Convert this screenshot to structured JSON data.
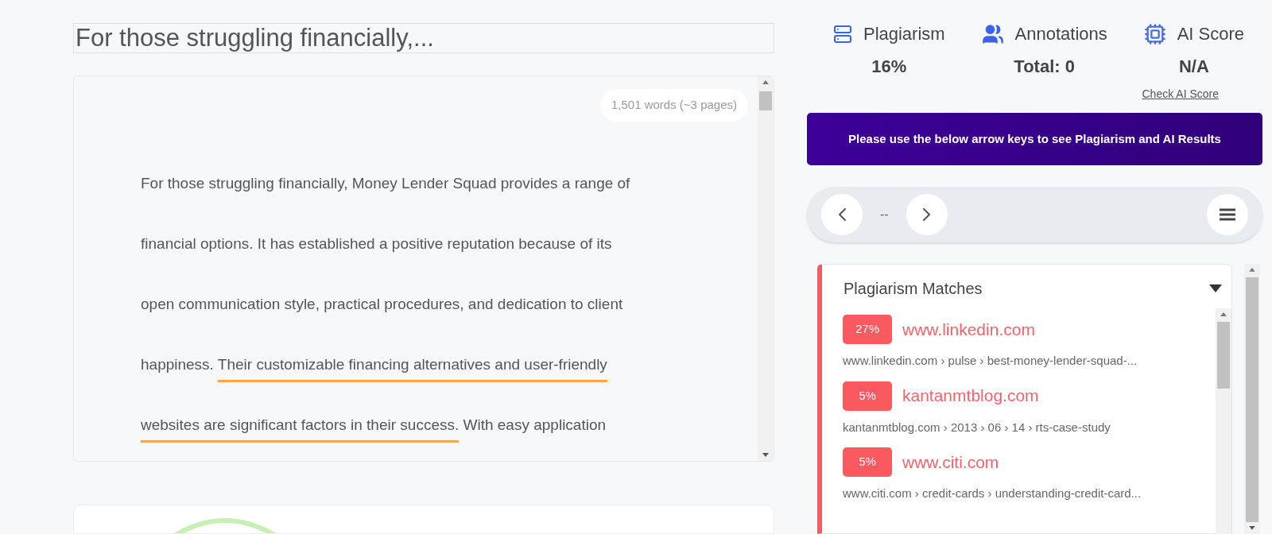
{
  "title_field": {
    "value": "For those struggling financially,..."
  },
  "editor": {
    "word_count": "1,501 words (~3 pages)",
    "lines": [
      [
        {
          "text": "For those struggling financially, Money Lender Squad provides a range of",
          "highlighted": false
        }
      ],
      [
        {
          "text": "financial options. It has established a positive reputation because of its",
          "highlighted": false
        }
      ],
      [
        {
          "text": "open communication style, practical procedures, and dedication to client",
          "highlighted": false
        }
      ],
      [
        {
          "text": "happiness. ",
          "highlighted": false
        },
        {
          "text": "Their customizable financing alternatives and user-friendly",
          "highlighted": true
        }
      ],
      [
        {
          "text": "websites are significant factors in their success.",
          "highlighted": true
        },
        {
          "text": " With easy application",
          "highlighted": false
        }
      ]
    ]
  },
  "stats": [
    {
      "kind": "plagiarism",
      "label": "Plagiarism",
      "value": "16%"
    },
    {
      "kind": "annotations",
      "label": "Annotations",
      "value": "Total: 0"
    },
    {
      "kind": "ai",
      "label": "AI Score",
      "value": "N/A"
    }
  ],
  "check_ai_link": "Check AI Score",
  "banner": "Please use the below arrow keys to see Plagiarism and AI Results",
  "navigator": {
    "position": "--"
  },
  "matches_panel": {
    "title": "Plagiarism Matches",
    "expanded": true,
    "items": [
      {
        "percent": "27%",
        "site": "www.linkedin.com",
        "path": "www.linkedin.com › pulse › best-money-lender-squad-..."
      },
      {
        "percent": "5%",
        "site": "kantanmtblog.com",
        "path": "kantanmtblog.com › 2013 › 06 › 14 › rts-case-study"
      },
      {
        "percent": "5%",
        "site": "www.citi.com",
        "path": "www.citi.com › credit-cards › understanding-credit-card..."
      }
    ]
  }
}
